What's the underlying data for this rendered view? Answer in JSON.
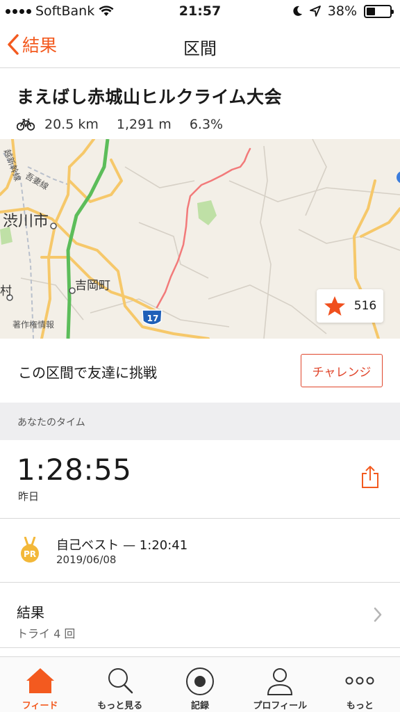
{
  "status_bar": {
    "carrier": "SoftBank",
    "time": "21:57",
    "battery": "38%",
    "battery_level": 0.38
  },
  "nav": {
    "back_label": "結果",
    "title": "区間"
  },
  "segment": {
    "name": "まえばし赤城山ヒルクライム大会",
    "distance": "20.5 km",
    "elevation": "1,291 m",
    "grade": "6.3%"
  },
  "map": {
    "labels": {
      "city": "渋川市",
      "town": "吉岡町",
      "village": "村",
      "line_shinkansen": "越新幹線",
      "line_agatsuma": "吾妻線",
      "attribution": "著作権情報",
      "route_shield": "17"
    },
    "star_count": "516",
    "route_color": "#f27a7a"
  },
  "challenge": {
    "text": "この区間で友達に挑戦",
    "button_label": "チャレンジ"
  },
  "your_time": {
    "section_label": "あなたのタイム",
    "time": "1:28:55",
    "date": "昨日"
  },
  "personal_best": {
    "medal_label": "PR",
    "title": "自己ベスト — 1:20:41",
    "date": "2019/06/08"
  },
  "results": {
    "title": "結果",
    "subtitle": "トライ 4 回"
  },
  "tabs": [
    {
      "label": "フィード",
      "icon": "home-icon",
      "active": true
    },
    {
      "label": "もっと見る",
      "icon": "search-icon",
      "active": false
    },
    {
      "label": "記録",
      "icon": "record-icon",
      "active": false
    },
    {
      "label": "プロフィール",
      "icon": "profile-icon",
      "active": false
    },
    {
      "label": "もっと",
      "icon": "more-icon",
      "active": false
    }
  ],
  "colors": {
    "accent": "#f35a1f",
    "challenge": "#e0452b",
    "star": "#f0501e",
    "medal": "#f3b839"
  }
}
